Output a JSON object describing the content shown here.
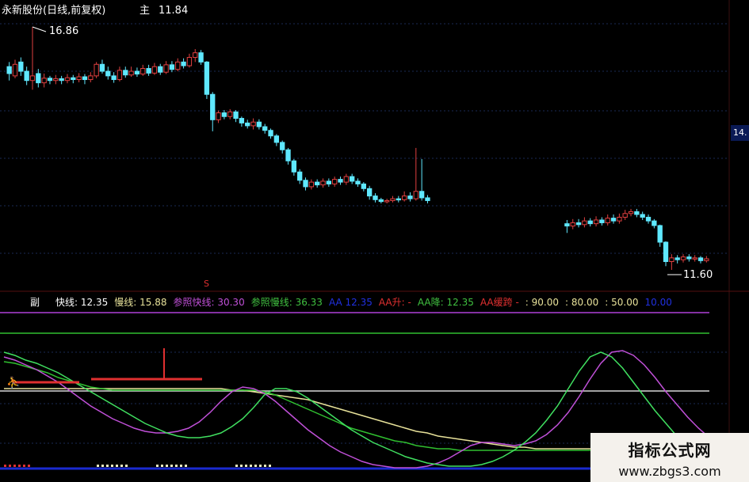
{
  "title": "永新股份(日线,前复权)",
  "main_label": "主",
  "main_value": "11.84",
  "price_top_tag": "14.",
  "annotations": {
    "high": "16.86",
    "low": "11.60",
    "marker": "S"
  },
  "sub_label": "副",
  "indicators": [
    {
      "label": "快线:",
      "value": "12.35",
      "color": "#ffffff"
    },
    {
      "label": "慢线:",
      "value": "15.88",
      "color": "#e8e29a"
    },
    {
      "label": "参照快线:",
      "value": "30.30",
      "color": "#c050d8"
    },
    {
      "label": "参照慢线:",
      "value": "36.33",
      "color": "#40c040"
    },
    {
      "label": "AA",
      "value": "12.35",
      "color": "#2030e0"
    },
    {
      "label": "AA升:",
      "value": "-",
      "color": "#e03030"
    },
    {
      "label": "AA降:",
      "value": "12.35",
      "color": "#40c040"
    },
    {
      "label": "AA缓跨",
      "value": "-",
      "color": "#e03030"
    },
    {
      "label": ":",
      "value": "90.00",
      "color": "#e8e29a"
    },
    {
      "label": ":",
      "value": "80.00",
      "color": "#e8e29a"
    },
    {
      "label": ":",
      "value": "50.00",
      "color": "#e8e29a"
    },
    {
      "label": "",
      "value": "10.00",
      "color": "#2030e0"
    }
  ],
  "watermark": {
    "line1": "指标公式网",
    "line2": "www.zbgs3.com"
  },
  "chart_data": {
    "type": "candlestick",
    "price_high": 16.86,
    "price_low": 11.6,
    "candles": [
      {
        "o": 16.0,
        "c": 15.85,
        "h": 16.1,
        "l": 15.7
      },
      {
        "o": 15.8,
        "c": 16.05,
        "h": 16.15,
        "l": 15.75
      },
      {
        "o": 16.1,
        "c": 15.9,
        "h": 16.2,
        "l": 15.8
      },
      {
        "o": 15.9,
        "c": 15.7,
        "h": 16.0,
        "l": 15.6
      },
      {
        "o": 15.7,
        "c": 15.8,
        "h": 16.86,
        "l": 15.5
      },
      {
        "o": 15.85,
        "c": 15.65,
        "h": 15.95,
        "l": 15.55
      },
      {
        "o": 15.65,
        "c": 15.75,
        "h": 15.85,
        "l": 15.55
      },
      {
        "o": 15.75,
        "c": 15.7,
        "h": 15.8,
        "l": 15.62
      },
      {
        "o": 15.7,
        "c": 15.74,
        "h": 15.82,
        "l": 15.62
      },
      {
        "o": 15.74,
        "c": 15.7,
        "h": 15.8,
        "l": 15.62
      },
      {
        "o": 15.7,
        "c": 15.76,
        "h": 15.84,
        "l": 15.64
      },
      {
        "o": 15.76,
        "c": 15.72,
        "h": 15.82,
        "l": 15.64
      },
      {
        "o": 15.72,
        "c": 15.78,
        "h": 15.86,
        "l": 15.66
      },
      {
        "o": 15.78,
        "c": 15.72,
        "h": 15.84,
        "l": 15.62
      },
      {
        "o": 15.72,
        "c": 15.8,
        "h": 15.88,
        "l": 15.66
      },
      {
        "o": 15.8,
        "c": 16.05,
        "h": 16.1,
        "l": 15.75
      },
      {
        "o": 16.05,
        "c": 15.9,
        "h": 16.15,
        "l": 15.85
      },
      {
        "o": 15.9,
        "c": 15.8,
        "h": 16.0,
        "l": 15.72
      },
      {
        "o": 15.8,
        "c": 15.72,
        "h": 15.88,
        "l": 15.65
      },
      {
        "o": 15.72,
        "c": 15.92,
        "h": 16.0,
        "l": 15.68
      },
      {
        "o": 15.92,
        "c": 15.82,
        "h": 16.0,
        "l": 15.76
      },
      {
        "o": 15.82,
        "c": 15.9,
        "h": 16.0,
        "l": 15.78
      },
      {
        "o": 15.9,
        "c": 15.84,
        "h": 15.98,
        "l": 15.78
      },
      {
        "o": 15.84,
        "c": 15.96,
        "h": 16.04,
        "l": 15.8
      },
      {
        "o": 15.96,
        "c": 15.86,
        "h": 16.04,
        "l": 15.8
      },
      {
        "o": 15.86,
        "c": 16.0,
        "h": 16.08,
        "l": 15.82
      },
      {
        "o": 16.0,
        "c": 15.88,
        "h": 16.06,
        "l": 15.82
      },
      {
        "o": 15.88,
        "c": 16.04,
        "h": 16.12,
        "l": 15.84
      },
      {
        "o": 16.04,
        "c": 15.94,
        "h": 16.12,
        "l": 15.88
      },
      {
        "o": 15.94,
        "c": 16.1,
        "h": 16.18,
        "l": 15.9
      },
      {
        "o": 16.1,
        "c": 16.02,
        "h": 16.18,
        "l": 15.96
      },
      {
        "o": 16.02,
        "c": 16.2,
        "h": 16.28,
        "l": 15.98
      },
      {
        "o": 16.2,
        "c": 16.3,
        "h": 16.38,
        "l": 16.1
      },
      {
        "o": 16.3,
        "c": 16.1,
        "h": 16.36,
        "l": 16.04
      },
      {
        "o": 16.1,
        "c": 15.4,
        "h": 16.12,
        "l": 15.3
      },
      {
        "o": 15.4,
        "c": 14.85,
        "h": 15.45,
        "l": 14.6
      },
      {
        "o": 14.85,
        "c": 15.0,
        "h": 15.05,
        "l": 14.78
      },
      {
        "o": 15.0,
        "c": 14.92,
        "h": 15.06,
        "l": 14.86
      },
      {
        "o": 14.92,
        "c": 15.02,
        "h": 15.08,
        "l": 14.86
      },
      {
        "o": 15.02,
        "c": 14.88,
        "h": 15.06,
        "l": 14.8
      },
      {
        "o": 14.88,
        "c": 14.78,
        "h": 14.92,
        "l": 14.7
      },
      {
        "o": 14.78,
        "c": 14.72,
        "h": 14.85,
        "l": 14.66
      },
      {
        "o": 14.72,
        "c": 14.8,
        "h": 14.88,
        "l": 14.64
      },
      {
        "o": 14.8,
        "c": 14.7,
        "h": 14.86,
        "l": 14.64
      },
      {
        "o": 14.7,
        "c": 14.62,
        "h": 14.76,
        "l": 14.55
      },
      {
        "o": 14.62,
        "c": 14.5,
        "h": 14.66,
        "l": 14.44
      },
      {
        "o": 14.5,
        "c": 14.36,
        "h": 14.54,
        "l": 14.28
      },
      {
        "o": 14.36,
        "c": 14.2,
        "h": 14.4,
        "l": 14.12
      },
      {
        "o": 14.2,
        "c": 13.96,
        "h": 14.24,
        "l": 13.88
      },
      {
        "o": 13.96,
        "c": 13.72,
        "h": 14.0,
        "l": 13.64
      },
      {
        "o": 13.72,
        "c": 13.54,
        "h": 13.78,
        "l": 13.46
      },
      {
        "o": 13.54,
        "c": 13.4,
        "h": 13.6,
        "l": 13.32
      },
      {
        "o": 13.4,
        "c": 13.5,
        "h": 13.56,
        "l": 13.34
      },
      {
        "o": 13.5,
        "c": 13.44,
        "h": 13.56,
        "l": 13.38
      },
      {
        "o": 13.44,
        "c": 13.52,
        "h": 13.58,
        "l": 13.38
      },
      {
        "o": 13.52,
        "c": 13.46,
        "h": 13.58,
        "l": 13.4
      },
      {
        "o": 13.46,
        "c": 13.56,
        "h": 13.62,
        "l": 13.4
      },
      {
        "o": 13.56,
        "c": 13.5,
        "h": 13.62,
        "l": 13.44
      },
      {
        "o": 13.5,
        "c": 13.62,
        "h": 13.68,
        "l": 13.44
      },
      {
        "o": 13.62,
        "c": 13.52,
        "h": 13.68,
        "l": 13.46
      },
      {
        "o": 13.52,
        "c": 13.46,
        "h": 13.58,
        "l": 13.4
      },
      {
        "o": 13.46,
        "c": 13.36,
        "h": 13.5,
        "l": 13.3
      },
      {
        "o": 13.36,
        "c": 13.2,
        "h": 13.42,
        "l": 13.12
      },
      {
        "o": 13.2,
        "c": 13.12,
        "h": 13.26,
        "l": 13.06
      },
      {
        "o": 13.12,
        "c": 13.08,
        "h": 13.16,
        "l": 13.04
      },
      {
        "o": 13.08,
        "c": 13.1,
        "h": 13.14,
        "l": 13.04
      },
      {
        "o": 13.1,
        "c": 13.14,
        "h": 13.2,
        "l": 13.06
      },
      {
        "o": 13.14,
        "c": 13.12,
        "h": 13.2,
        "l": 13.06
      },
      {
        "o": 13.12,
        "c": 13.2,
        "h": 13.3,
        "l": 13.08
      },
      {
        "o": 13.2,
        "c": 13.14,
        "h": 13.28,
        "l": 13.08
      },
      {
        "o": 13.14,
        "c": 13.3,
        "h": 14.24,
        "l": 13.1
      },
      {
        "o": 13.3,
        "c": 13.16,
        "h": 14.0,
        "l": 13.1
      },
      {
        "o": 13.16,
        "c": 13.1,
        "h": 13.22,
        "l": 13.04
      },
      null,
      null,
      null,
      null,
      null,
      null,
      null,
      null,
      null,
      null,
      null,
      null,
      null,
      null,
      null,
      null,
      null,
      null,
      null,
      null,
      null,
      null,
      null,
      {
        "o": 12.6,
        "c": 12.55,
        "h": 12.68,
        "l": 12.4
      },
      {
        "o": 12.55,
        "c": 12.62,
        "h": 12.7,
        "l": 12.48
      },
      {
        "o": 12.62,
        "c": 12.58,
        "h": 12.7,
        "l": 12.52
      },
      {
        "o": 12.58,
        "c": 12.66,
        "h": 12.74,
        "l": 12.52
      },
      {
        "o": 12.66,
        "c": 12.6,
        "h": 12.72,
        "l": 12.54
      },
      {
        "o": 12.6,
        "c": 12.68,
        "h": 12.76,
        "l": 12.54
      },
      {
        "o": 12.68,
        "c": 12.62,
        "h": 12.74,
        "l": 12.56
      },
      {
        "o": 12.62,
        "c": 12.72,
        "h": 12.8,
        "l": 12.56
      },
      {
        "o": 12.72,
        "c": 12.66,
        "h": 12.8,
        "l": 12.6
      },
      {
        "o": 12.66,
        "c": 12.74,
        "h": 12.82,
        "l": 12.6
      },
      {
        "o": 12.74,
        "c": 12.82,
        "h": 12.9,
        "l": 12.68
      },
      {
        "o": 12.82,
        "c": 12.86,
        "h": 12.92,
        "l": 12.76
      },
      {
        "o": 12.86,
        "c": 12.8,
        "h": 12.92,
        "l": 12.74
      },
      {
        "o": 12.8,
        "c": 12.74,
        "h": 12.86,
        "l": 12.68
      },
      {
        "o": 12.74,
        "c": 12.66,
        "h": 12.8,
        "l": 12.6
      },
      {
        "o": 12.66,
        "c": 12.56,
        "h": 12.7,
        "l": 12.5
      },
      {
        "o": 12.56,
        "c": 12.2,
        "h": 12.58,
        "l": 12.1
      },
      {
        "o": 12.2,
        "c": 11.78,
        "h": 12.22,
        "l": 11.68
      },
      {
        "o": 11.78,
        "c": 11.86,
        "h": 11.94,
        "l": 11.6
      },
      {
        "o": 11.86,
        "c": 11.82,
        "h": 11.92,
        "l": 11.74
      },
      {
        "o": 11.82,
        "c": 11.88,
        "h": 11.94,
        "l": 11.76
      },
      {
        "o": 11.88,
        "c": 11.84,
        "h": 11.94,
        "l": 11.78
      },
      {
        "o": 11.84,
        "c": 11.86,
        "h": 11.92,
        "l": 11.78
      },
      {
        "o": 11.86,
        "c": 11.8,
        "h": 11.9,
        "l": 11.74
      },
      {
        "o": 11.8,
        "c": 11.84,
        "h": 11.9,
        "l": 11.76
      }
    ],
    "sub": {
      "levels": [
        90,
        80,
        50,
        10
      ],
      "fast_line": [
        75,
        73,
        70,
        68,
        65,
        62,
        58,
        54,
        50,
        46,
        42,
        38,
        34,
        30,
        27,
        24,
        22,
        21,
        21,
        22,
        24,
        28,
        33,
        40,
        48,
        52,
        52,
        50,
        46,
        41,
        36,
        31,
        26,
        22,
        18,
        15,
        12,
        9,
        7,
        5,
        4,
        3,
        3,
        3,
        4,
        6,
        9,
        13,
        18,
        24,
        32,
        41,
        52,
        63,
        72,
        75,
        72,
        65,
        56,
        47,
        38,
        30,
        22,
        16,
        11,
        8
      ],
      "slow_line": [
        52,
        52,
        52,
        52,
        52,
        52,
        52,
        52,
        52,
        52,
        52,
        52,
        52,
        52,
        52,
        52,
        52,
        52,
        52,
        52,
        52,
        51,
        51,
        50,
        49,
        48,
        47,
        46,
        45,
        43,
        41,
        39,
        37,
        35,
        33,
        31,
        29,
        27,
        25,
        24,
        22,
        21,
        20,
        19,
        18,
        17,
        16,
        15,
        15,
        14,
        14,
        14,
        14,
        14,
        14,
        14,
        14,
        14,
        14,
        14,
        14,
        14,
        14,
        14,
        14,
        14
      ],
      "ref_fast_line": [
        72,
        70,
        67,
        64,
        60,
        56,
        51,
        46,
        41,
        37,
        33,
        30,
        27,
        25,
        24,
        24,
        25,
        27,
        31,
        37,
        44,
        50,
        53,
        52,
        49,
        44,
        38,
        32,
        26,
        21,
        16,
        12,
        9,
        6,
        4,
        3,
        2,
        2,
        2,
        3,
        5,
        8,
        12,
        16,
        18,
        18,
        17,
        16,
        17,
        19,
        23,
        29,
        37,
        47,
        58,
        68,
        75,
        76,
        73,
        67,
        59,
        50,
        42,
        34,
        27,
        21
      ],
      "ref_slow_line": [
        69,
        68,
        66,
        64,
        62,
        59,
        57,
        55,
        53,
        52,
        51,
        51,
        51,
        51,
        51,
        51,
        51,
        51,
        51,
        51,
        51,
        51,
        51,
        51,
        50,
        48,
        45,
        42,
        39,
        36,
        33,
        30,
        27,
        25,
        23,
        21,
        19,
        18,
        16,
        15,
        14,
        14,
        13,
        13,
        13,
        13,
        13,
        13,
        13,
        13,
        13,
        13,
        13,
        13,
        13,
        13,
        13,
        13,
        13,
        13,
        13,
        13,
        13,
        13,
        13,
        13
      ]
    }
  }
}
